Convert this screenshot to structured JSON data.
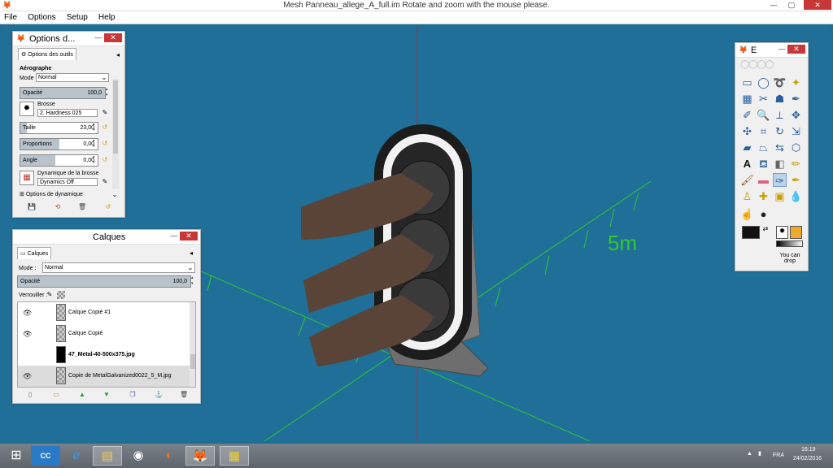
{
  "window": {
    "title": "Mesh Panneau_allege_A_full.im    Rotate and zoom with the mouse please.",
    "minimize": "—",
    "maximize": "▢",
    "close": "✕"
  },
  "menu": [
    "File",
    "Options",
    "Setup",
    "Help"
  ],
  "scene": {
    "distance_label": "5m"
  },
  "tool_options": {
    "title": "Options d...",
    "tab": "Options des outils",
    "tool_name": "Aérographe",
    "mode_label": "Mode :",
    "mode_value": "Normal",
    "opacity_label": "Opacité",
    "opacity_value": "100,0",
    "brush_label": "Brosse",
    "brush_value": "2. Hardness 025",
    "size_label": "Taille",
    "size_value": "23,00",
    "aspect_label": "Proportions",
    "aspect_value": "0,00",
    "angle_label": "Angle",
    "angle_value": "0,00",
    "dynamics_label": "Dynamique de la brosse",
    "dynamics_value": "Dynamics Off",
    "dynamics_options": "Options de dynamique"
  },
  "layers": {
    "title": "Calques",
    "tab": "Calques",
    "mode_label": "Mode :",
    "mode_value": "Normal",
    "opacity_label": "Opacité",
    "opacity_value": "100,0",
    "lock_label": "Verrouiller :",
    "items": [
      {
        "name": "Calque Copié #1",
        "visible": true,
        "bold": false
      },
      {
        "name": "Calque Copié",
        "visible": true,
        "bold": false
      },
      {
        "name": "47_Metal-40-500x375.jpg",
        "visible": false,
        "bold": true
      },
      {
        "name": "Copie de MetalGalvanized0022_5_M.jpg",
        "visible": true,
        "bold": false
      }
    ]
  },
  "toolbox": {
    "title": "E",
    "hint": "You can drop"
  },
  "taskbar": {
    "language": "FRA",
    "time": "16:19",
    "date": "24/02/2016"
  },
  "colors": {
    "viewport": "#1f6f98",
    "grid": "#2fc82f",
    "axis": "#d02020",
    "fg": "#111111",
    "bg": "#ffffff",
    "accent": "#f0a830"
  }
}
